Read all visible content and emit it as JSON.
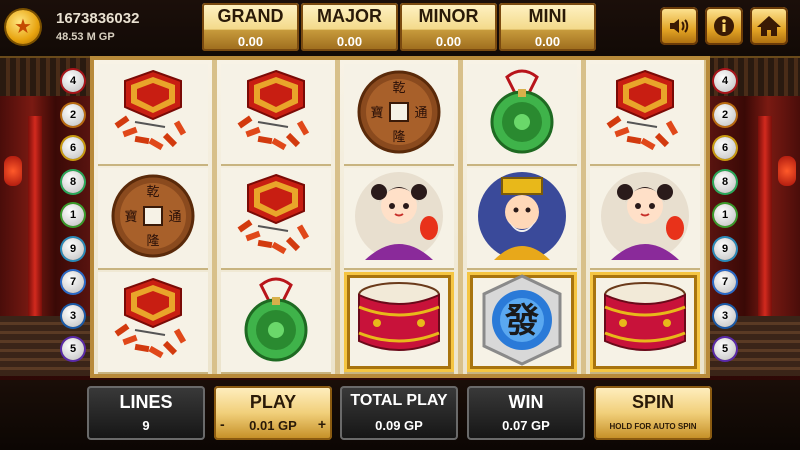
{
  "account": {
    "id": "1673836032",
    "balance": "48.53 M GP"
  },
  "jackpots": [
    {
      "label": "GRAND",
      "value": "0.00"
    },
    {
      "label": "MAJOR",
      "value": "0.00"
    },
    {
      "label": "MINOR",
      "value": "0.00"
    },
    {
      "label": "MINI",
      "value": "0.00"
    }
  ],
  "toolbar": {
    "sound_icon": "speaker-icon",
    "info_icon": "info-icon",
    "home_icon": "home-icon"
  },
  "line_markers": {
    "left": [
      "4",
      "2",
      "6",
      "8",
      "1",
      "9",
      "7",
      "3",
      "5"
    ],
    "right": [
      "4",
      "2",
      "6",
      "8",
      "1",
      "9",
      "7",
      "3",
      "5"
    ]
  },
  "reels": [
    [
      "firecrackers",
      "coin",
      "firecrackers"
    ],
    [
      "firecrackers",
      "firecrackers",
      "jade"
    ],
    [
      "coin",
      "girl",
      "drum"
    ],
    [
      "jade",
      "god",
      "fa"
    ],
    [
      "firecrackers",
      "girl",
      "drum"
    ]
  ],
  "winning_cells": [
    [
      2,
      2
    ],
    [
      3,
      2
    ],
    [
      4,
      2
    ]
  ],
  "bottom": {
    "lines_label": "LINES",
    "lines_value": "9",
    "play_label": "PLAY",
    "play_value": "0.01 GP",
    "minus": "-",
    "plus": "+",
    "total_label": "TOTAL PLAY",
    "total_value": "0.09 GP",
    "win_label": "WIN",
    "win_value": "0.07 GP",
    "spin_label": "SPIN",
    "spin_hint": "HOLD FOR AUTO SPIN"
  },
  "symbol_text": {
    "fa": "發",
    "coin_chars": [
      "乾",
      "通",
      "隆",
      "寶"
    ]
  },
  "colors": {
    "gold": "#f1cf7a",
    "jade": "#3fb34a",
    "red": "#d32a1e"
  }
}
